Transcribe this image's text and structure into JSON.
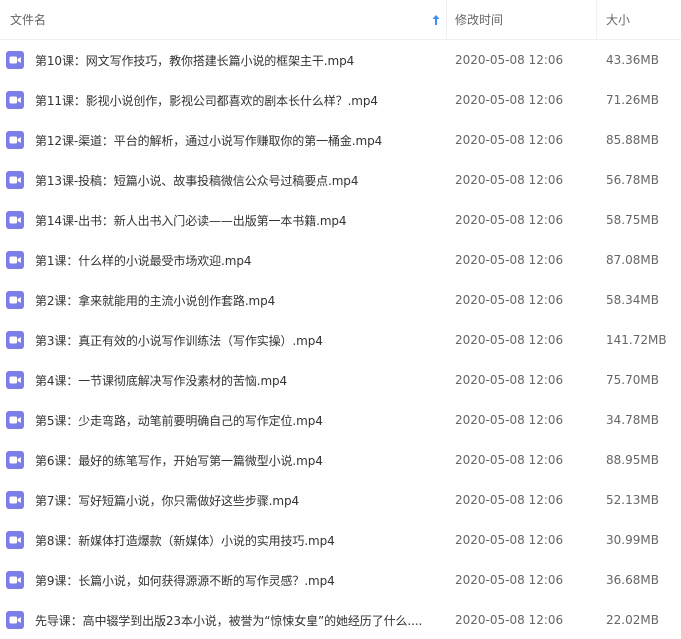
{
  "header": {
    "name_label": "文件名",
    "time_label": "修改时间",
    "size_label": "大小",
    "sort_icon": "sort-ascending-arrow-icon"
  },
  "colors": {
    "accent": "#3b8cff",
    "icon_purple": "#7b7ee6"
  },
  "files": [
    {
      "name": "第10课：网文写作技巧，教你搭建长篇小说的框架主干.mp4",
      "time": "2020-05-08 12:06",
      "size": "43.36MB",
      "icon": "video-file-icon"
    },
    {
      "name": "第11课：影视小说创作，影视公司都喜欢的剧本长什么样？.mp4",
      "time": "2020-05-08 12:06",
      "size": "71.26MB",
      "icon": "video-file-icon"
    },
    {
      "name": "第12课-渠道：平台的解析，通过小说写作赚取你的第一桶金.mp4",
      "time": "2020-05-08 12:06",
      "size": "85.88MB",
      "icon": "video-file-icon"
    },
    {
      "name": "第13课-投稿：短篇小说、故事投稿微信公众号过稿要点.mp4",
      "time": "2020-05-08 12:06",
      "size": "56.78MB",
      "icon": "video-file-icon"
    },
    {
      "name": "第14课-出书：新人出书入门必读——出版第一本书籍.mp4",
      "time": "2020-05-08 12:06",
      "size": "58.75MB",
      "icon": "video-file-icon"
    },
    {
      "name": "第1课：什么样的小说最受市场欢迎.mp4",
      "time": "2020-05-08 12:06",
      "size": "87.08MB",
      "icon": "video-file-icon"
    },
    {
      "name": "第2课：拿来就能用的主流小说创作套路.mp4",
      "time": "2020-05-08 12:06",
      "size": "58.34MB",
      "icon": "video-file-icon"
    },
    {
      "name": "第3课：真正有效的小说写作训练法（写作实操）.mp4",
      "time": "2020-05-08 12:06",
      "size": "141.72MB",
      "icon": "video-file-icon"
    },
    {
      "name": "第4课：一节课彻底解决写作没素材的苦恼.mp4",
      "time": "2020-05-08 12:06",
      "size": "75.70MB",
      "icon": "video-file-icon"
    },
    {
      "name": "第5课：少走弯路，动笔前要明确自己的写作定位.mp4",
      "time": "2020-05-08 12:06",
      "size": "34.78MB",
      "icon": "video-file-icon"
    },
    {
      "name": "第6课：最好的练笔写作，开始写第一篇微型小说.mp4",
      "time": "2020-05-08 12:06",
      "size": "88.95MB",
      "icon": "video-file-icon"
    },
    {
      "name": "第7课：写好短篇小说，你只需做好这些步骤.mp4",
      "time": "2020-05-08 12:06",
      "size": "52.13MB",
      "icon": "video-file-icon"
    },
    {
      "name": "第8课：新媒体打造爆款（新媒体）小说的实用技巧.mp4",
      "time": "2020-05-08 12:06",
      "size": "30.99MB",
      "icon": "video-file-icon"
    },
    {
      "name": "第9课：长篇小说，如何获得源源不断的写作灵感？.mp4",
      "time": "2020-05-08 12:06",
      "size": "36.68MB",
      "icon": "video-file-icon"
    },
    {
      "name": "先导课：高中辍学到出版23本小说，被誉为“惊悚女皇”的她经历了什么....",
      "time": "2020-05-08 12:06",
      "size": "22.02MB",
      "icon": "video-file-icon"
    }
  ]
}
